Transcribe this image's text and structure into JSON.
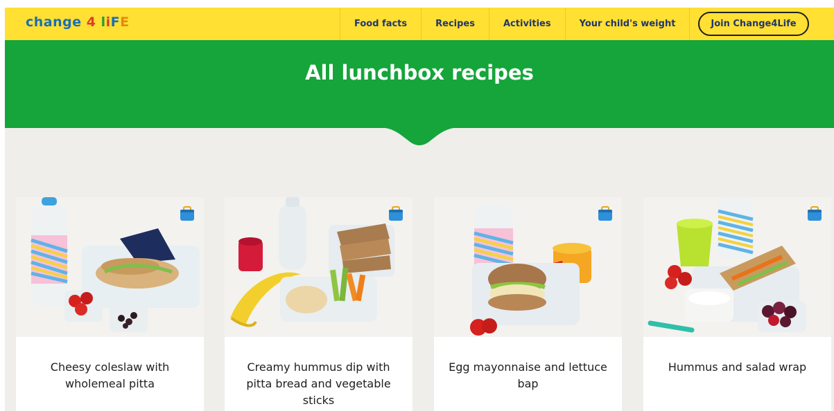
{
  "header": {
    "logo": {
      "part1": "change",
      "part2": "4",
      "letters": [
        "l",
        "i",
        "F",
        "E"
      ]
    },
    "nav": [
      "Food facts",
      "Recipes",
      "Activities",
      "Your child's weight"
    ],
    "join_label": "Join Change4Life"
  },
  "hero": {
    "title": "All lunchbox recipes"
  },
  "colors": {
    "header": "#ffe033",
    "hero": "#15a53a",
    "background": "#efeeea",
    "nav_text": "#22366b",
    "lunchbox_icon": "#2f8fd8"
  },
  "cards": [
    {
      "title": "Cheesy coleslaw with wholemeal pitta",
      "icon": "lunchbox-icon"
    },
    {
      "title": "Creamy hummus dip with pitta bread and vegetable sticks",
      "icon": "lunchbox-icon"
    },
    {
      "title": "Egg mayonnaise and lettuce bap",
      "icon": "lunchbox-icon"
    },
    {
      "title": "Hummus and salad wrap",
      "icon": "lunchbox-icon"
    }
  ]
}
